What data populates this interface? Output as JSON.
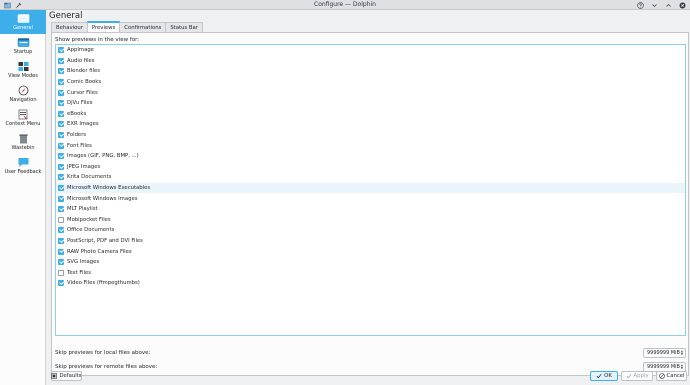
{
  "window": {
    "title": "Configure — Dolphin"
  },
  "sidebar": {
    "items": [
      {
        "label": "General",
        "icon": "general-icon",
        "active": true
      },
      {
        "label": "Startup",
        "icon": "startup-icon",
        "active": false
      },
      {
        "label": "View Modes",
        "icon": "view-modes-icon",
        "active": false
      },
      {
        "label": "Navigation",
        "icon": "navigation-icon",
        "active": false
      },
      {
        "label": "Context Menu",
        "icon": "context-menu-icon",
        "active": false
      },
      {
        "label": "Wastebin",
        "icon": "wastebin-icon",
        "active": false
      },
      {
        "label": "User Feedback",
        "icon": "user-feedback-icon",
        "active": false
      }
    ]
  },
  "main": {
    "title": "General",
    "tabs": [
      {
        "label": "Behaviour",
        "active": false
      },
      {
        "label": "Previews",
        "active": true
      },
      {
        "label": "Confirmations",
        "active": false
      },
      {
        "label": "Status Bar",
        "active": false
      }
    ],
    "list_heading": "Show previews in the view for:",
    "preview_items": [
      {
        "name": "AppImage",
        "checked": true
      },
      {
        "name": "Audio files",
        "checked": true
      },
      {
        "name": "Blender files",
        "checked": true
      },
      {
        "name": "Comic Books",
        "checked": true
      },
      {
        "name": "Cursor Files",
        "checked": true
      },
      {
        "name": "DjVu Files",
        "checked": true
      },
      {
        "name": "eBooks",
        "checked": true
      },
      {
        "name": "EXR Images",
        "checked": true
      },
      {
        "name": "Folders",
        "checked": true
      },
      {
        "name": "Font Files",
        "checked": true
      },
      {
        "name": "Images (GIF, PNG, BMP, ...)",
        "checked": true
      },
      {
        "name": "JPEG Images",
        "checked": true
      },
      {
        "name": "Krita Documents",
        "checked": true
      },
      {
        "name": "Microsoft Windows Executables",
        "checked": true
      },
      {
        "name": "Microsoft Windows Images",
        "checked": true
      },
      {
        "name": "MLT Playlist",
        "checked": true
      },
      {
        "name": "Mobipocket Files",
        "checked": false
      },
      {
        "name": "Office Documents",
        "checked": true
      },
      {
        "name": "PostScript, PDF and DVI Files",
        "checked": true
      },
      {
        "name": "RAW Photo Camera Files",
        "checked": true
      },
      {
        "name": "SVG Images",
        "checked": true
      },
      {
        "name": "Text Files",
        "checked": false
      },
      {
        "name": "Video Files (ffmpegthumbs)",
        "checked": true
      }
    ],
    "skip_local": {
      "label": "Skip previews for local files above:",
      "value": "9999999 MiB"
    },
    "skip_remote": {
      "label": "Skip previews for remote files above:",
      "value": "9999999 MiB"
    }
  },
  "footer": {
    "defaults": "Defaults",
    "ok": "OK",
    "apply": "Apply",
    "cancel": "Cancel"
  },
  "colors": {
    "accent": "#3daee9",
    "window_bg": "#eff0f1",
    "view_bg": "#fcfcfc"
  }
}
